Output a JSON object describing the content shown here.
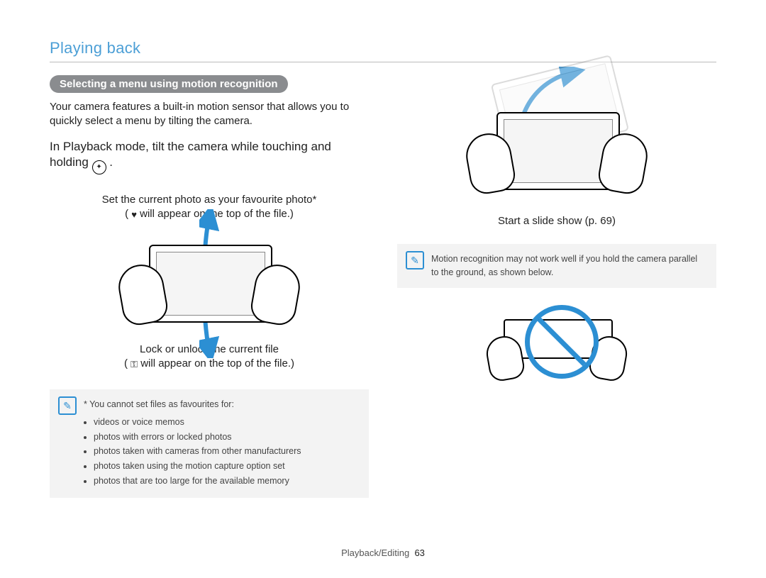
{
  "page_title": "Playing back",
  "footer": {
    "section": "Playback/Editing",
    "page": "63"
  },
  "section_heading": "Selecting a menu using motion recognition",
  "intro": "Your camera features a built-in motion sensor that allows you to quickly select a menu by tilting the camera.",
  "instruction": {
    "line1": "In Playback mode, tilt the camera while touching and",
    "line2_before_icon": "holding ",
    "line2_after_icon": ".",
    "icon_name": "motion-touch-icon"
  },
  "left": {
    "fig1_caption_line1": "Set the current photo as your favourite photo*",
    "fig1_caption_line2_before": "(",
    "fig1_caption_line2_mid": " will appear on the top of the file.)",
    "fig1_icon": "heart-icon",
    "fig2_caption_line1": "Lock or unlock the current file",
    "fig2_caption_line2_before": "(",
    "fig2_caption_line2_mid": " will appear on the top of the file.)",
    "fig2_icon": "key-icon",
    "note_lead": "* You cannot set files as favourites for:",
    "note_items": [
      "videos or voice memos",
      "photos with errors or locked photos",
      "photos taken with cameras from other manufacturers",
      "photos taken using the motion capture option set",
      "photos that are too large for the available memory"
    ]
  },
  "right": {
    "slideshow_caption": "Start a slide show (p. 69)",
    "warn_text": "Motion recognition may not work well if you hold the camera parallel to the ground, as shown below."
  }
}
